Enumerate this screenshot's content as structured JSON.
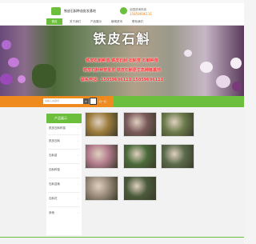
{
  "header": {
    "logo_text": "铁皮石斛种苗批发基地",
    "phone_label": "全国咨询热线",
    "phone_number": "15859696111"
  },
  "nav": {
    "items": [
      "首页",
      "关于我们",
      "产品展示",
      "新闻资讯",
      "联系我们"
    ]
  },
  "banner": {
    "title": "铁皮石斛",
    "line1": "铁皮石斛种苗 铁皮石斛 石斛苗 石斛种苗",
    "line2": "铁皮石斛种苗批发 铁皮石斛原生态种植基地",
    "line3": "联系电话：15859696111 15859696111"
  },
  "search": {
    "placeholder": "请输入关键词",
    "button_icon": "search-icon",
    "qr_label": "扫一扫"
  },
  "sidebar": {
    "title": "产品展示",
    "items": [
      "铁皮石斛种苗",
      "铁皮石斛",
      "石斛苗",
      "石斛种苗",
      "石斛盆栽",
      "石斛花",
      "其他"
    ]
  },
  "products": {
    "tiles": [
      {
        "color": "#9a7a3a"
      },
      {
        "color": "#7a5a5a"
      },
      {
        "color": "#6a7a4a"
      },
      {
        "color": "#b07a8a"
      },
      {
        "color": "#4a6a3a"
      },
      {
        "color": "#5a6a4a"
      },
      {
        "color": "#9a8a7a"
      },
      {
        "color": "#4a5a3a"
      }
    ]
  },
  "colors": {
    "primary_green": "#6bbf3c",
    "accent_orange": "#ef8a1e",
    "banner_text_red": "#ff2a2a"
  }
}
